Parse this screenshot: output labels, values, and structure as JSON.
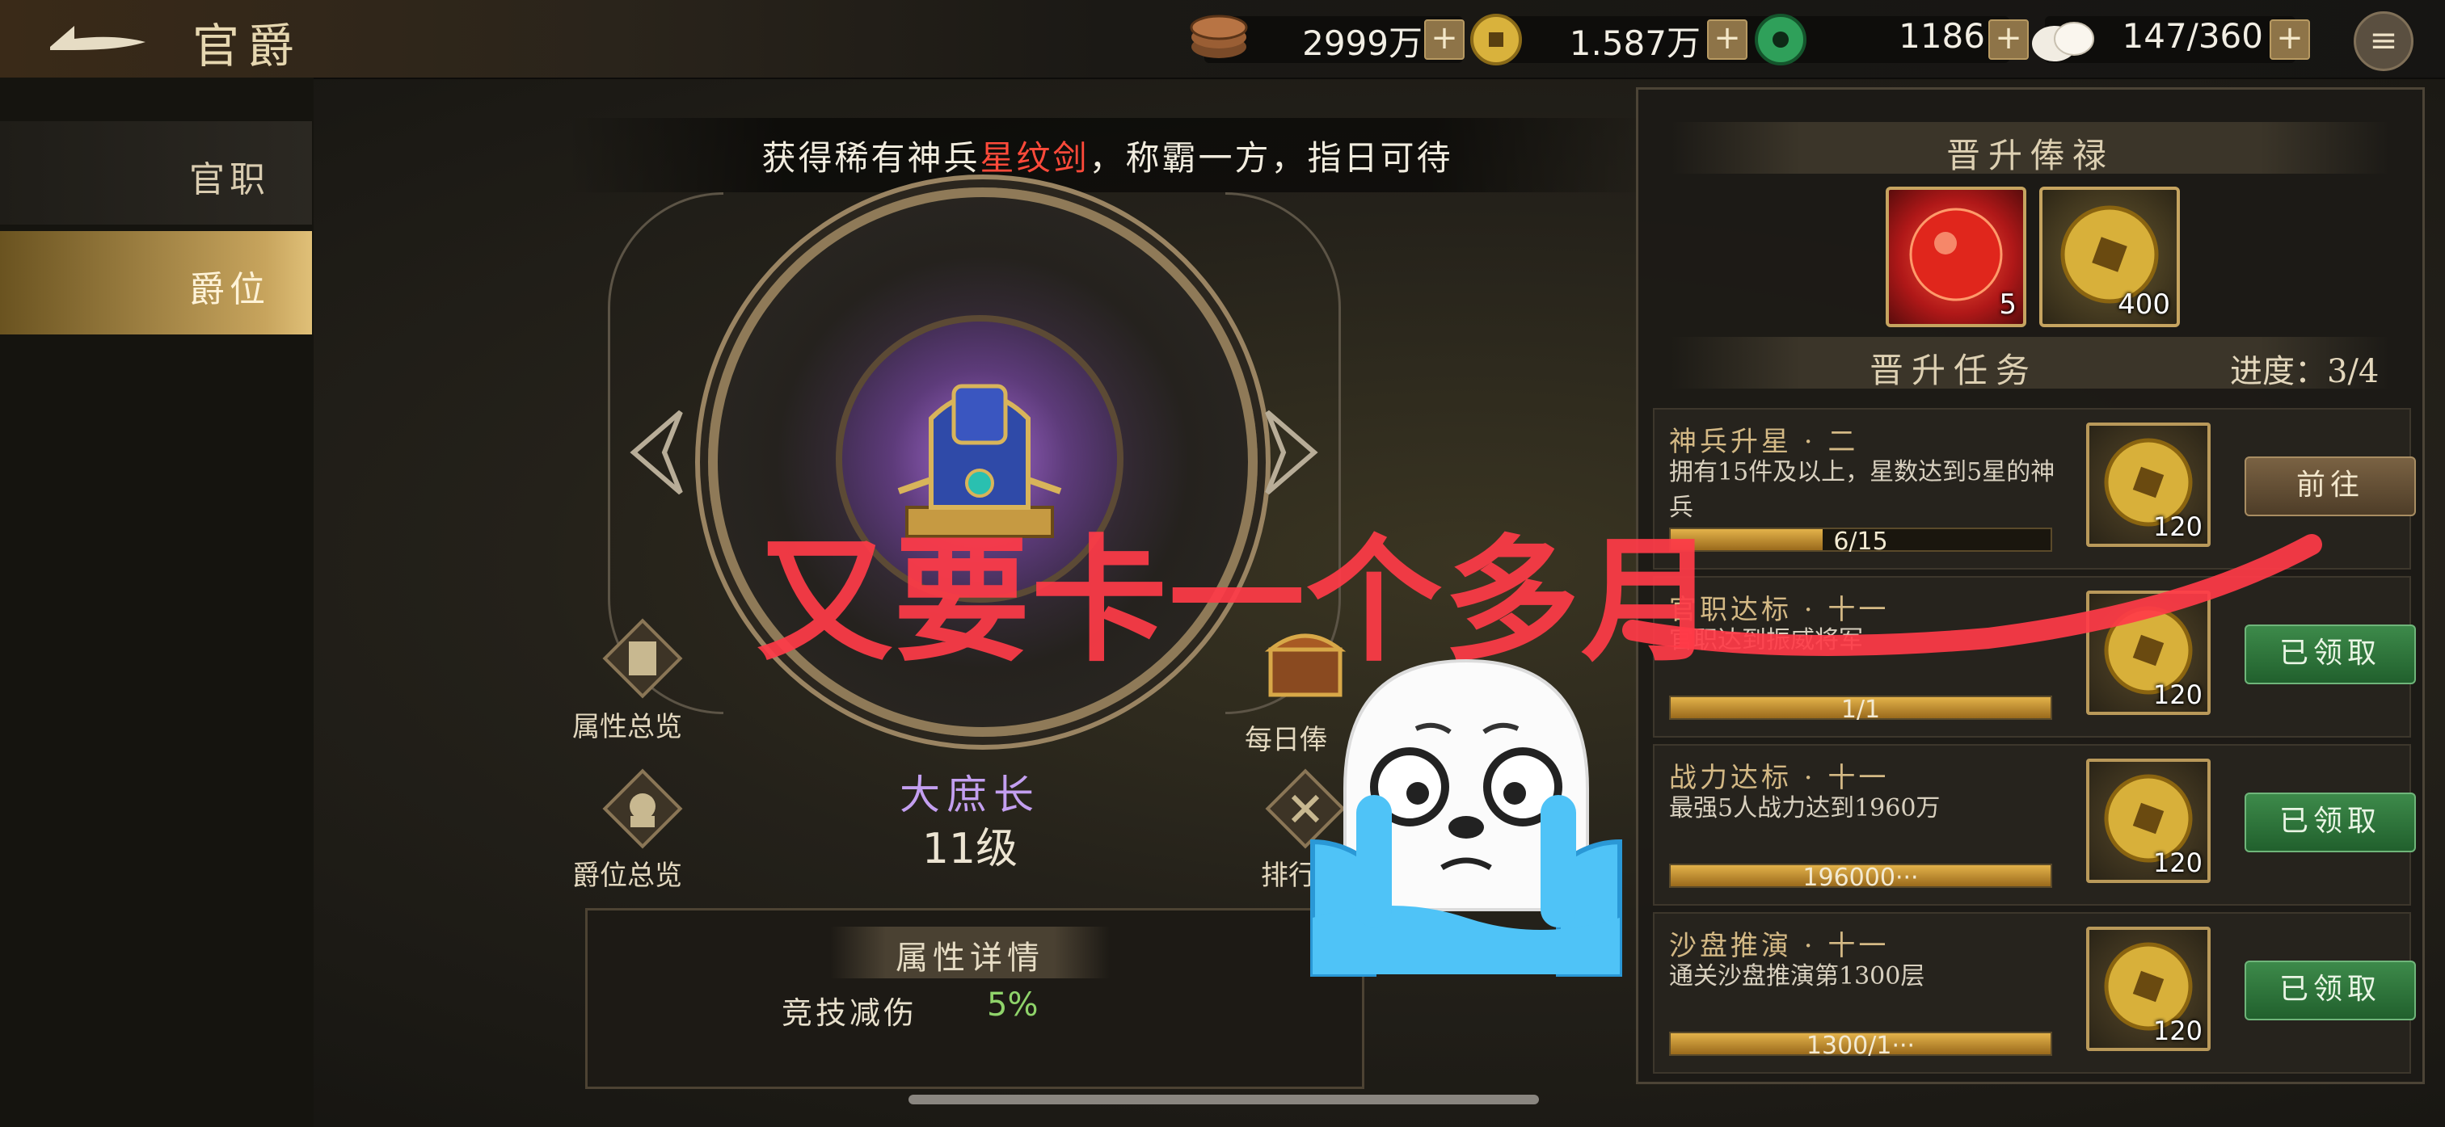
{
  "header": {
    "title": "官爵",
    "resources": [
      {
        "icon": "copper-coins-icon",
        "value": "2999万"
      },
      {
        "icon": "gold-coin-icon",
        "value": "1.587万"
      },
      {
        "icon": "jade-icon",
        "value": "1186"
      },
      {
        "icon": "steamed-bun-icon",
        "value": "147/360"
      }
    ],
    "plus_label": "+"
  },
  "sidebar": {
    "items": [
      {
        "label": "官职",
        "active": false
      },
      {
        "label": "爵位",
        "active": true
      }
    ]
  },
  "main": {
    "banner": {
      "prefix": "获得稀有神兵",
      "highlight": "星纹剑",
      "suffix": "，称霸一方，指日可待"
    },
    "left_buttons": [
      {
        "label": "属性总览",
        "icon": "scroll-icon"
      },
      {
        "label": "爵位总览",
        "icon": "lion-seal-icon"
      }
    ],
    "right_buttons": [
      {
        "label": "每日俸",
        "icon": "treasure-chest-icon"
      },
      {
        "label": "排行",
        "icon": "ranking-icon"
      }
    ],
    "rank_name": "大庶长",
    "rank_level": "11级",
    "attributes": {
      "title": "属性详情",
      "items": [
        {
          "label": "竞技减伤",
          "value": "5%"
        }
      ]
    }
  },
  "right_panel": {
    "rewards_title": "晋升俸禄",
    "rewards": [
      {
        "icon": "red-orb-icon",
        "count": "5"
      },
      {
        "icon": "gold-coin-icon",
        "count": "400"
      }
    ],
    "tasks_title": "晋升任务",
    "progress_text": "进度：3/4",
    "tasks": [
      {
        "title": "神兵升星 · 二",
        "desc": "拥有15件及以上，星数达到5星的神兵",
        "progress_text": "6/15",
        "progress": 0.4,
        "reward": "120",
        "button": "前往",
        "done": false
      },
      {
        "title": "官职达标 · 十一",
        "desc": "官职达到振威将军",
        "progress_text": "1/1",
        "progress": 1.0,
        "reward": "120",
        "button": "已领取",
        "done": true
      },
      {
        "title": "战力达标 · 十一",
        "desc": "最强5人战力达到1960万",
        "progress_text": "196000···",
        "progress": 1.0,
        "reward": "120",
        "button": "已领取",
        "done": true
      },
      {
        "title": "沙盘推演 · 十一",
        "desc": "通关沙盘推演第1300层",
        "progress_text": "1300/1···",
        "progress": 1.0,
        "reward": "120",
        "button": "已领取",
        "done": true
      }
    ]
  },
  "overlay": {
    "text": "又要卡一个多月",
    "sticker": "crying-seal-emoji"
  },
  "colors": {
    "accent_gold": "#c7a45d",
    "highlight_red": "#ff4a3a",
    "rank_purple": "#c39ff0",
    "value_green": "#8fd36a",
    "done_green": "#2f7a3c"
  }
}
